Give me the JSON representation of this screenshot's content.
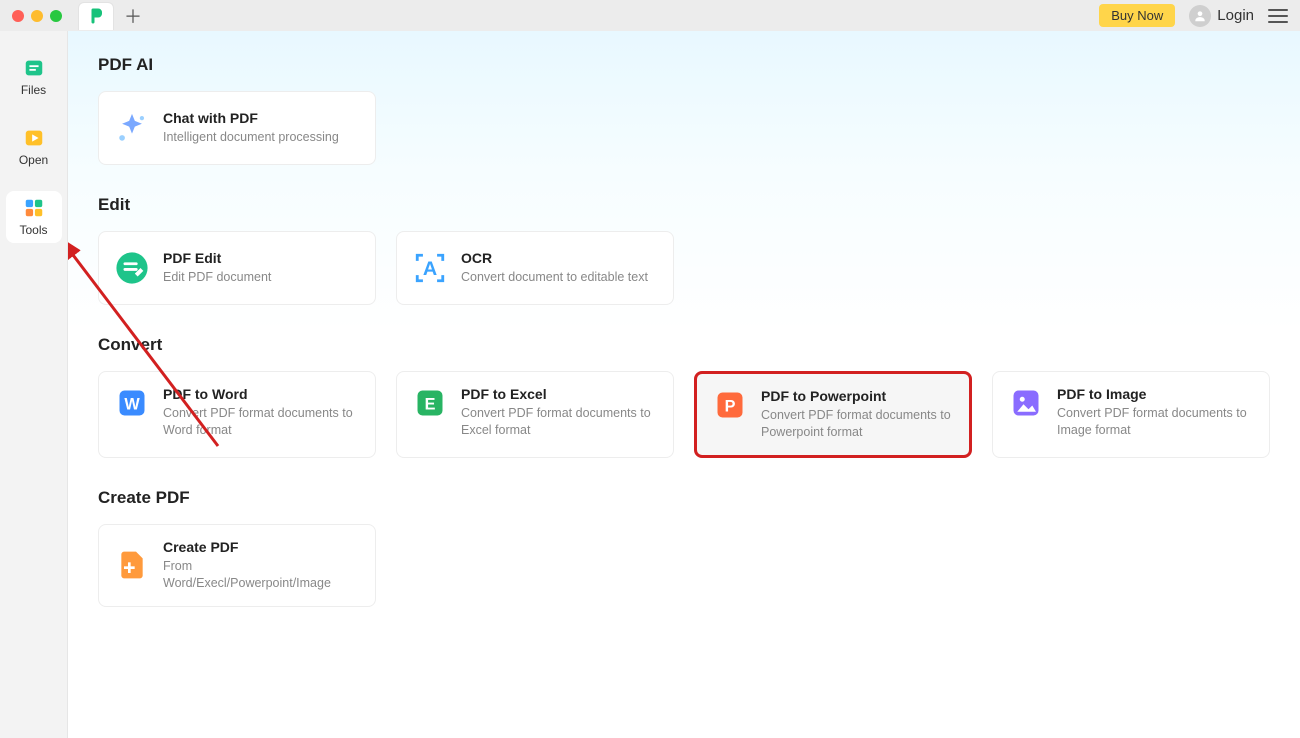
{
  "titlebar": {
    "buy_label": "Buy Now",
    "login_label": "Login"
  },
  "sidebar": {
    "items": [
      {
        "label": "Files"
      },
      {
        "label": "Open"
      },
      {
        "label": "Tools"
      }
    ]
  },
  "sections": {
    "pdf_ai": {
      "title": "PDF AI",
      "cards": [
        {
          "title": "Chat with PDF",
          "desc": "Intelligent document processing"
        }
      ]
    },
    "edit": {
      "title": "Edit",
      "cards": [
        {
          "title": "PDF Edit",
          "desc": "Edit PDF document"
        },
        {
          "title": "OCR",
          "desc": "Convert document to editable text"
        }
      ]
    },
    "convert": {
      "title": "Convert",
      "cards": [
        {
          "title": "PDF to Word",
          "desc": "Convert PDF format documents to Word format"
        },
        {
          "title": "PDF to Excel",
          "desc": "Convert PDF format documents to Excel format"
        },
        {
          "title": "PDF to Powerpoint",
          "desc": "Convert PDF format documents to Powerpoint format"
        },
        {
          "title": "PDF to Image",
          "desc": "Convert PDF format documents to Image format"
        }
      ]
    },
    "create": {
      "title": "Create PDF",
      "cards": [
        {
          "title": "Create PDF",
          "desc": "From Word/Execl/Powerpoint/Image"
        }
      ]
    }
  }
}
